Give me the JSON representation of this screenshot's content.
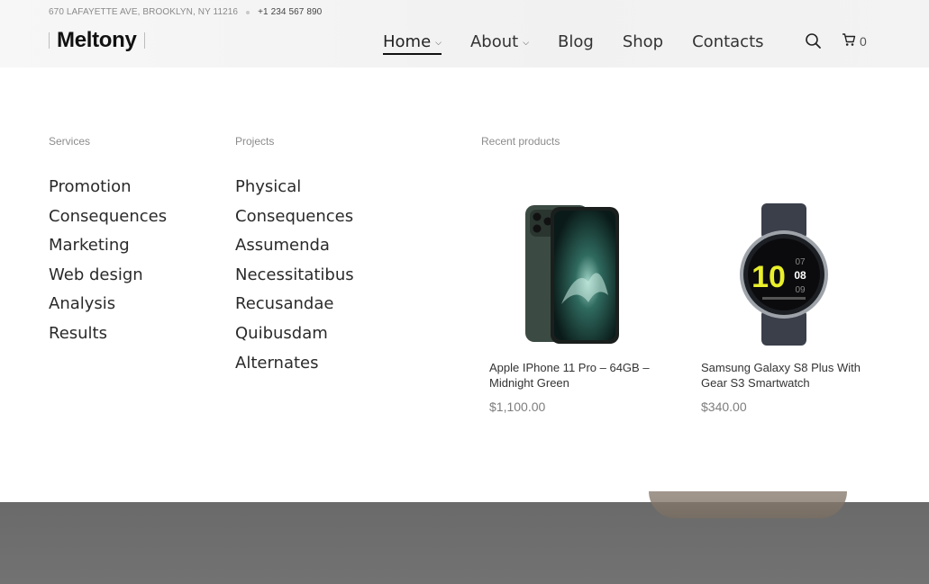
{
  "topbar": {
    "address": "670 LAFAYETTE AVE, BROOKLYN, NY 11216",
    "phone": "+1 234 567 890"
  },
  "logo": {
    "text": "Meltony"
  },
  "nav": {
    "items": [
      {
        "label": "Home",
        "has_dropdown": true,
        "active": true
      },
      {
        "label": "About",
        "has_dropdown": true,
        "active": false
      },
      {
        "label": "Blog",
        "has_dropdown": false,
        "active": false
      },
      {
        "label": "Shop",
        "has_dropdown": false,
        "active": false
      },
      {
        "label": "Contacts",
        "has_dropdown": false,
        "active": false
      }
    ],
    "search_icon": "search-icon",
    "cart_icon": "cart-icon",
    "cart_count": "0"
  },
  "mega_menu": {
    "services": {
      "title": "Services",
      "items": [
        "Promotion",
        "Consequences",
        "Marketing",
        "Web design",
        "Analysis",
        "Results"
      ]
    },
    "projects": {
      "title": "Projects",
      "items": [
        "Physical",
        "Consequences",
        "Assumenda",
        "Necessitatibus",
        "Recusandae",
        "Quibusdam",
        "Alternates"
      ]
    },
    "recent_products": {
      "title": "Recent products",
      "products": [
        {
          "name": "Apple IPhone 11 Pro – 64GB – Midnight Green",
          "price": "$1,100.00",
          "image": "phone-image"
        },
        {
          "name": "Samsung Galaxy S8 Plus With Gear S3 Smartwatch",
          "price": "$340.00",
          "image": "smartwatch-image"
        }
      ]
    }
  },
  "watch_face": {
    "hour": "10",
    "min1": "07",
    "min2": "08",
    "min3": "09"
  },
  "colors": {
    "header_bg": "#f4f4f4",
    "text": "#222222",
    "muted": "#8c8c8c",
    "backdrop": "#6e6e6e"
  }
}
